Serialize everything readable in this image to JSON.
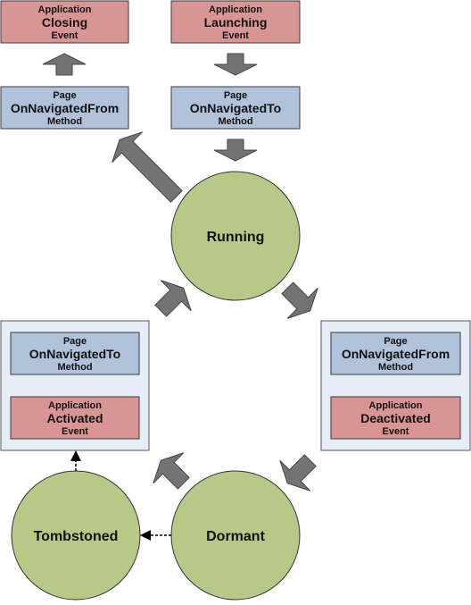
{
  "colors": {
    "event_fill": "#d99594",
    "method_fill": "#b0c3db",
    "state_fill": "#b6c986",
    "container_fill": "#e6edf7",
    "arrow_fill": "#737373",
    "border": "#3a3a3a"
  },
  "boxes": {
    "closing": {
      "top": "Application",
      "main": "Closing",
      "bottom": "Event"
    },
    "launching": {
      "top": "Application",
      "main": "Launching",
      "bottom": "Event"
    },
    "nav_from_top": {
      "top": "Page",
      "main": "OnNavigatedFrom",
      "bottom": "Method"
    },
    "nav_to_top": {
      "top": "Page",
      "main": "OnNavigatedTo",
      "bottom": "Method"
    },
    "nav_to_left": {
      "top": "Page",
      "main": "OnNavigatedTo",
      "bottom": "Method"
    },
    "activated": {
      "top": "Application",
      "main": "Activated",
      "bottom": "Event"
    },
    "nav_from_right": {
      "top": "Page",
      "main": "OnNavigatedFrom",
      "bottom": "Method"
    },
    "deactivated": {
      "top": "Application",
      "main": "Deactivated",
      "bottom": "Event"
    }
  },
  "states": {
    "running": "Running",
    "dormant": "Dormant",
    "tombstoned": "Tombstoned"
  }
}
